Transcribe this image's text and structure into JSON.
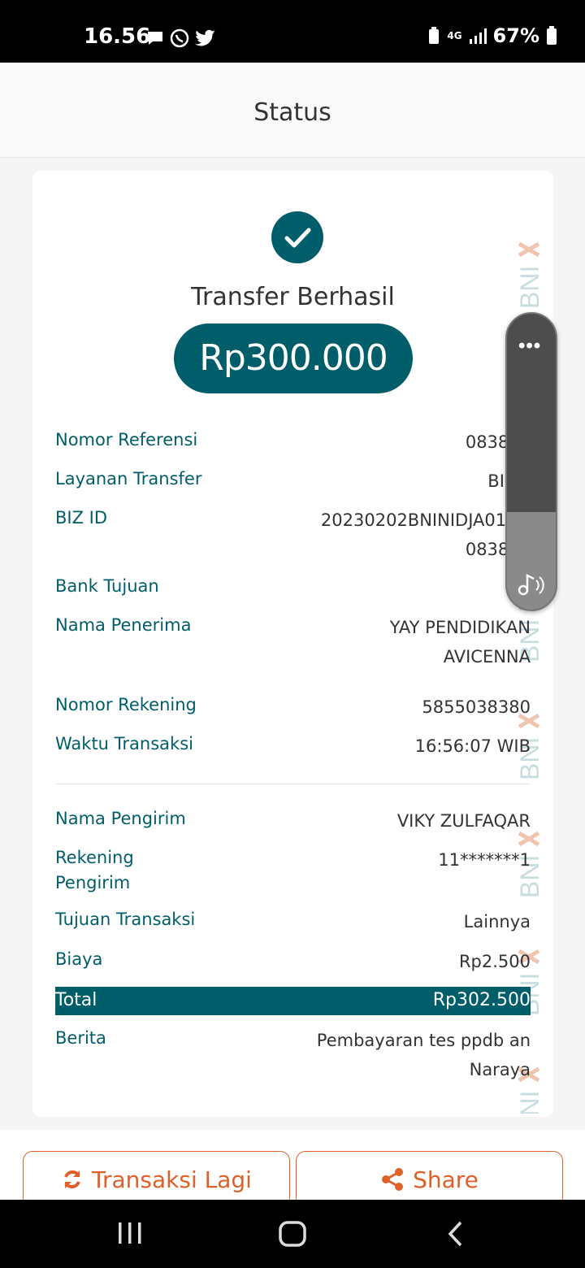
{
  "status_bar": {
    "time": "16.56",
    "network": "4G",
    "battery": "67%"
  },
  "header": {
    "title": "Status"
  },
  "receipt": {
    "title": "Transfer Berhasil",
    "amount": "Rp300.000",
    "rows": [
      {
        "label": "Nomor Referensi",
        "value": "083842"
      },
      {
        "label": "Layanan Transfer",
        "value": "BI-FA"
      },
      {
        "label": "BIZ ID",
        "value_line1": "20230202BNINIDJA010O",
        "value_line2": "083842"
      },
      {
        "label": "Bank Tujuan",
        "value": "B"
      },
      {
        "label": "Nama Penerima",
        "value_line1": "YAY PENDIDIKAN",
        "value_line2": "AVICENNA"
      },
      {
        "label": "Nomor Rekening",
        "value": "5855038380"
      },
      {
        "label": "Waktu Transaksi",
        "value": "16:56:07 WIB"
      },
      {
        "label": "Nama Pengirim",
        "value": "VIKY ZULFAQAR"
      },
      {
        "label_line1": "Rekening",
        "label_line2": "Pengirim",
        "value": "11*******1"
      },
      {
        "label": "Tujuan Transaksi",
        "value": "Lainnya"
      },
      {
        "label": "Biaya",
        "value": "Rp2.500"
      },
      {
        "label": "Total",
        "value": "Rp302.500"
      },
      {
        "label": "Berita",
        "value_line1": "Pembayaran tes ppdb an",
        "value_line2": "Naraya"
      }
    ],
    "watermark_text": "BNI"
  },
  "actions": {
    "again_label": "Transaksi Lagi",
    "share_label": "Share"
  },
  "colors": {
    "primary": "#005e6a",
    "accent": "#e0602a"
  }
}
